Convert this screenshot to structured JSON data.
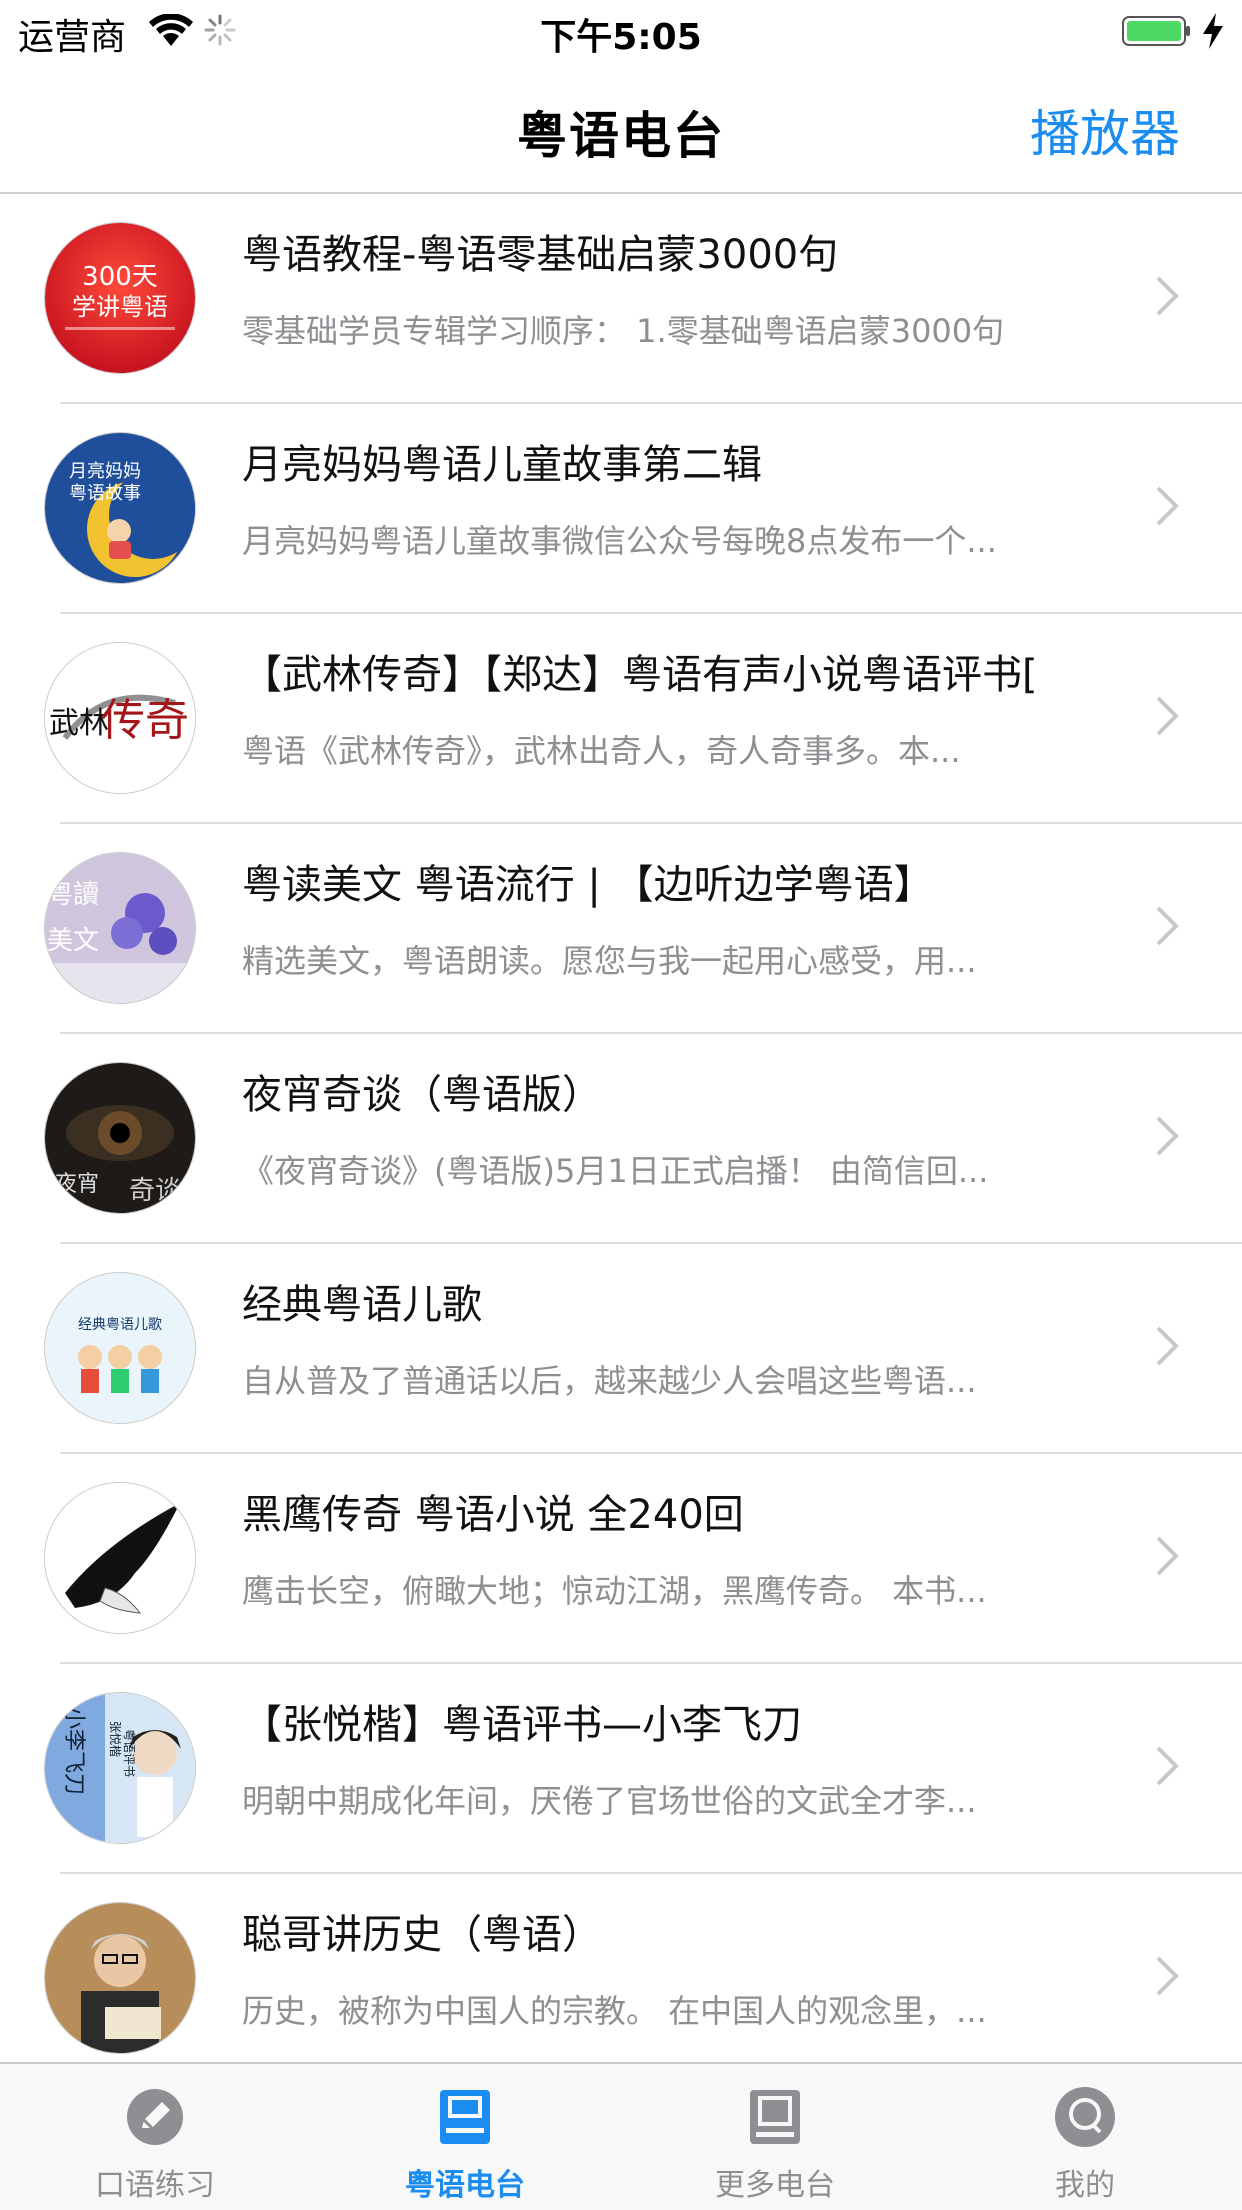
{
  "status_bar": {
    "carrier": "运营商",
    "time": "下午5:05"
  },
  "nav": {
    "title": "粤语电台",
    "player_button": "播放器"
  },
  "stations": [
    {
      "title": "粤语教程-粤语零基础启蒙3000句",
      "subtitle": "零基础学员专辑学习顺序： 1.零基础粤语启蒙3000句",
      "thumb_text": [
        "300天",
        "学讲粤语"
      ]
    },
    {
      "title": "月亮妈妈粤语儿童故事第二辑",
      "subtitle": "月亮妈妈粤语儿童故事微信公众号每晚8点发布一个...",
      "thumb_text": [
        "月亮妈妈",
        "粤语故事"
      ]
    },
    {
      "title": "【武林传奇】【郑达】粤语有声小说粤语评书[",
      "subtitle": "粤语《武林传奇》，武林出奇人，奇人奇事多。本...",
      "thumb_text": [
        "武林",
        "传奇"
      ]
    },
    {
      "title": "粤读美文 粤语流行 | 【边听边学粤语】",
      "subtitle": "精选美文，粤语朗读。愿您与我一起用心感受，用...",
      "thumb_text": [
        "粤讀",
        "美文"
      ]
    },
    {
      "title": "夜宵奇谈（粤语版）",
      "subtitle": "《夜宵奇谈》(粤语版)5月1日正式启播！ 由简信回...",
      "thumb_text": [
        "夜宵",
        "奇谈"
      ]
    },
    {
      "title": "经典粤语儿歌",
      "subtitle": "自从普及了普通话以后，越来越少人会唱这些粤语...",
      "thumb_text": [
        "经典粤语儿歌"
      ]
    },
    {
      "title": "黑鹰传奇 粤语小说 全240回",
      "subtitle": "鹰击长空，俯瞰大地；惊动江湖，黑鹰传奇。 本书...",
      "thumb_text": []
    },
    {
      "title": "【张悦楷】粤语评书—小李飞刀",
      "subtitle": "明朝中期成化年间，厌倦了官场世俗的文武全才李...",
      "thumb_text": [
        "小李飞刀",
        "张悦楷",
        "粤语评书"
      ]
    },
    {
      "title": "聪哥讲历史（粤语）",
      "subtitle": "历史，被称为中国人的宗教。 在中国人的观念里，...",
      "thumb_text": []
    }
  ],
  "tabs": [
    {
      "label": "口语练习",
      "icon": "pencil-icon",
      "active": false
    },
    {
      "label": "粤语电台",
      "icon": "radio-book-icon",
      "active": true
    },
    {
      "label": "更多电台",
      "icon": "book-icon",
      "active": false
    },
    {
      "label": "我的",
      "icon": "profile-icon",
      "active": false
    }
  ],
  "colors": {
    "accent": "#1b8cf0",
    "inactive": "#8e8e93",
    "battery": "#4cd964"
  }
}
